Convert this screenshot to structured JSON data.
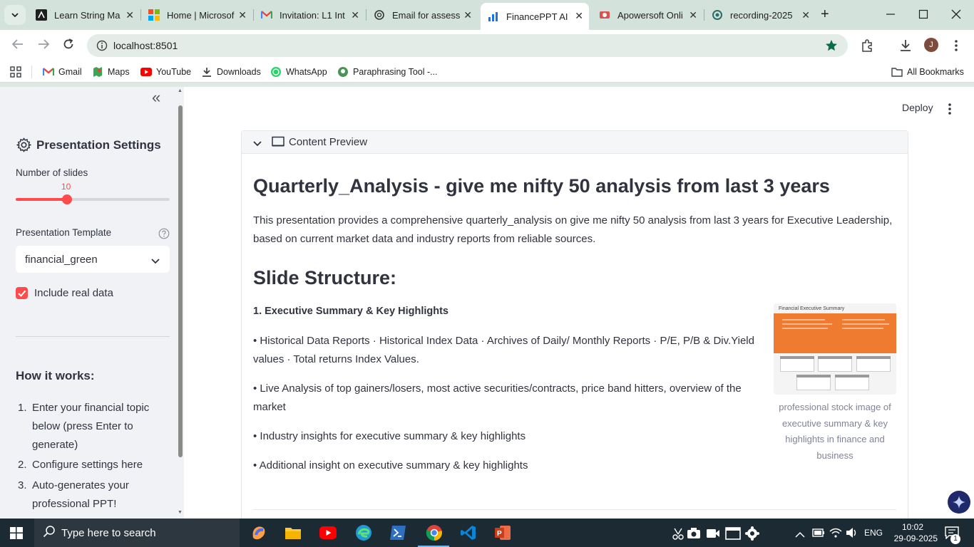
{
  "browser": {
    "tabs": [
      {
        "label": "Learn String Ma"
      },
      {
        "label": "Home | Microsof"
      },
      {
        "label": "Invitation: L1 Int"
      },
      {
        "label": "Email for assess"
      },
      {
        "label": "FinancePPT AI"
      },
      {
        "label": "Apowersoft Onli"
      },
      {
        "label": "recording-2025"
      }
    ],
    "new_tab": "+",
    "url": "localhost:8501",
    "profile_initial": "J",
    "bookmarks": [
      {
        "label": "Gmail"
      },
      {
        "label": "Maps"
      },
      {
        "label": "YouTube"
      },
      {
        "label": "Downloads"
      },
      {
        "label": "WhatsApp"
      },
      {
        "label": "Paraphrasing Tool -..."
      }
    ],
    "all_bookmarks": "All Bookmarks"
  },
  "app": {
    "deploy": "Deploy",
    "collapse": "«"
  },
  "sidebar": {
    "title": "Presentation Settings",
    "slides_label": "Number of slides",
    "slides_value": "10",
    "slides_fraction": 0.333,
    "template_label": "Presentation Template",
    "template_value": "financial_green",
    "include_real_data": "Include real data",
    "how_title": "How it works:",
    "steps": [
      {
        "num": "1.",
        "line1": "Enter your financial topic",
        "line2": "below (press Enter to",
        "line3": "generate)"
      },
      {
        "num": "2.",
        "line1": "Configure settings here"
      },
      {
        "num": "3.",
        "line1": "Auto-generates your",
        "line2": "professional PPT!"
      }
    ]
  },
  "preview": {
    "expander_label": "Content Preview",
    "title": "Quarterly_Analysis - give me nifty 50 analysis from last 3 years",
    "intro_line1": "This presentation provides a comprehensive quarterly_analysis on give me nifty 50 analysis from last 3 years for Executive Leadership,",
    "intro_line2": "based on current market data and industry reports from reliable sources.",
    "structure_heading": "Slide Structure:",
    "slide1_heading": "1. Executive Summary & Key Highlights",
    "bullets": [
      {
        "line1": "• Historical Data Reports · Historical Index Data · Archives of Daily/ Monthly Reports · P/E, P/B & Div.Yield",
        "line2": "values · Total returns Index Values."
      },
      {
        "line1": "• Live Analysis of top gainers/losers, most active securities/contracts, price band hitters, overview of the",
        "line2": "market"
      },
      {
        "line1": "• Industry insights for executive summary & key highlights"
      },
      {
        "line1": "• Additional insight on executive summary & key highlights"
      }
    ],
    "thumb_title": "Financial Executive Summary",
    "caption_line1": "professional stock image of",
    "caption_line2": "executive summary & key",
    "caption_line3": "highlights in finance and",
    "caption_line4": "business"
  },
  "taskbar": {
    "search_placeholder": "Type here to search",
    "lang": "ENG",
    "time": "10:02",
    "date": "29-09-2025",
    "notifications": "1"
  },
  "colors": {
    "accent": "#ff4b4b",
    "tabbar": "#d3e3dc",
    "thumb_orange": "#ee7b2f"
  }
}
